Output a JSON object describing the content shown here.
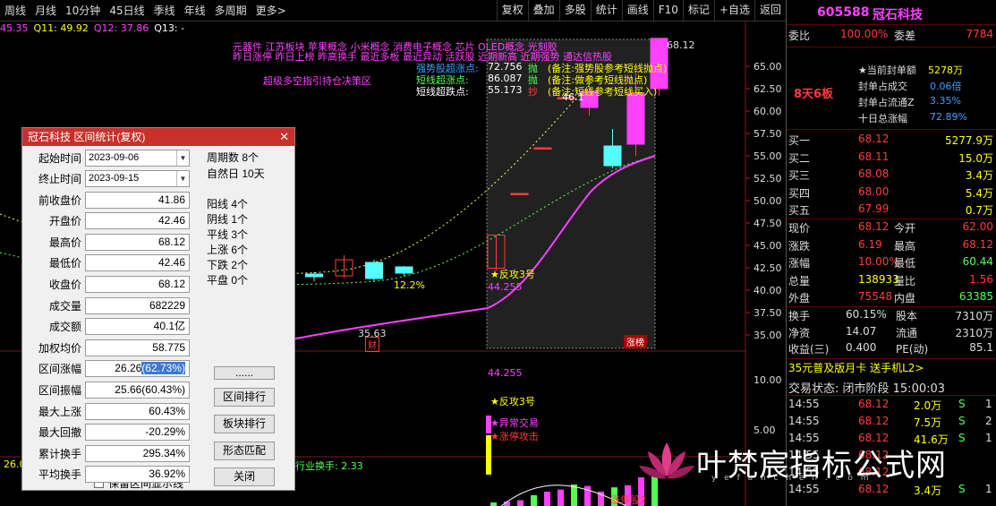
{
  "toolbar": {
    "left": [
      "周线",
      "月线",
      "10分钟",
      "45日线",
      "季线",
      "年线",
      "多周期",
      "更多>"
    ],
    "right": [
      "复权",
      "叠加",
      "多股",
      "统计",
      "画线",
      "F10",
      "标记",
      "+自选",
      "返回"
    ]
  },
  "ma_line": [
    {
      "text": "45.35",
      "color": "#ff40ff"
    },
    {
      "text": "Q11: 49.92",
      "color": "#ffff00"
    },
    {
      "text": "Q12: 37.86",
      "color": "#ff40ff"
    },
    {
      "text": "Q13: -",
      "color": "#ffffff"
    }
  ],
  "chart": {
    "y_axis_labels": [
      "65.00",
      "62.50",
      "60.00",
      "57.50",
      "55.00",
      "52.50",
      "50.00",
      "47.50",
      "45.00",
      "42.50",
      "40.00",
      "37.50",
      "35.00"
    ],
    "sub_axis_labels": [
      "10.00",
      "5.00"
    ],
    "high_price_label": "68.12",
    "low_price_label": "35.63",
    "pct_label": "12.2%",
    "start_marker": "46.1",
    "concepts_line1": "元器件  江苏板块  苹果概念 小米概念 消费电子概念 芯片 OLED概念 光刻胶",
    "concepts_line2": "昨日涨停 昨日上榜 昨高换手 最近多板 最近异动 活跃股 近期新高 近期强势 通达信热股",
    "indicator1": "超级多空指引持仓决策区",
    "signals": [
      {
        "label": "强势股超涨点:",
        "value": "72.756",
        "action": "抛",
        "note": "(备注:强势股参考短线抛点)"
      },
      {
        "label": "短线超涨点:",
        "value": "86.087",
        "action": "抛",
        "note": "(备注:做参考短线抛点)"
      },
      {
        "label": "短线超跌点:",
        "value": "55.173",
        "action": "抄",
        "note": "(备注:短线参考短线买入)"
      }
    ],
    "counter_attack": "★反攻3号",
    "counter_value": "44.255",
    "sub_counter_value": "44.255",
    "sub_counter_attack": "★反攻3号",
    "abnormal": "★异常交易",
    "limit_attack": "★涨停攻击",
    "industry_turnover": "行业换手: 2.33",
    "badge_cai": "财",
    "badge_zhangbang": "涨榜",
    "sub_level": "26.0",
    "bottom_note": "涨停股2"
  },
  "candles": [
    {
      "o": 36.9,
      "c": 37.1,
      "h": 37.4,
      "l": 36.6
    },
    {
      "o": 37.0,
      "c": 38.2,
      "h": 38.4,
      "l": 36.8
    },
    {
      "o": 37.4,
      "c": 38.7,
      "h": 38.9,
      "l": 37.2
    },
    {
      "o": 38.3,
      "c": 38.3,
      "h": 38.8,
      "l": 35.63
    },
    {
      "o": 38.2,
      "c": 38.5,
      "h": 38.7,
      "l": 37.9
    },
    {
      "o": 39.0,
      "c": 40.3,
      "h": 40.6,
      "l": 38.7
    },
    {
      "o": 41.1,
      "c": 39.9,
      "h": 41.5,
      "l": 39.6
    },
    {
      "o": 39.9,
      "c": 41.2,
      "h": 41.6,
      "l": 39.5
    },
    {
      "o": 41.2,
      "c": 40.8,
      "h": 42.0,
      "l": 40.3
    },
    {
      "o": 41.8,
      "c": 41.5,
      "h": 42.0,
      "l": 41.0
    },
    {
      "o": 41.6,
      "c": 43.4,
      "h": 43.9,
      "l": 41.4
    },
    {
      "o": 43.1,
      "c": 41.3,
      "h": 43.4,
      "l": 41.0
    },
    {
      "o": 42.6,
      "c": 41.9,
      "h": 42.7,
      "l": 41.6
    },
    {
      "o": 42.46,
      "c": 46.15,
      "h": 46.2,
      "l": 42.2
    },
    {
      "o": 50.8,
      "c": 50.8,
      "h": 50.8,
      "l": 50.8
    },
    {
      "o": 55.9,
      "c": 55.9,
      "h": 55.9,
      "l": 55.9
    },
    {
      "o": 61.5,
      "c": 61.5,
      "h": 61.5,
      "l": 61.5
    },
    {
      "o": 60.4,
      "c": 62.2,
      "h": 64.0,
      "l": 59.5
    },
    {
      "o": 56.1,
      "c": 53.9,
      "h": 58.0,
      "l": 53.6
    },
    {
      "o": 56.3,
      "c": 62.0,
      "h": 64.5,
      "l": 55.0
    },
    {
      "o": 62.5,
      "c": 68.12,
      "h": 68.12,
      "l": 61.7
    }
  ],
  "dialog": {
    "title": "冠石科技 区间统计(复权)",
    "close": "✕",
    "start_label": "起始时间",
    "start_value": "2023-09-06",
    "end_label": "终止时间",
    "end_value": "2023-09-15",
    "rows": [
      {
        "label": "前收盘价",
        "value": "41.86"
      },
      {
        "label": "开盘价",
        "value": "42.46"
      },
      {
        "label": "最高价",
        "value": "68.12"
      },
      {
        "label": "最低价",
        "value": "42.46"
      },
      {
        "label": "收盘价",
        "value": "68.12"
      },
      {
        "label": "成交量",
        "value": "682229"
      },
      {
        "label": "成交额",
        "value": "40.1亿"
      },
      {
        "label": "加权均价",
        "value": "58.775"
      },
      {
        "label": "区间涨幅",
        "value": "26.26",
        "hl": "(62.73%)"
      },
      {
        "label": "区间振幅",
        "value": "25.66(60.43%)"
      },
      {
        "label": "最大上涨",
        "value": "60.43%"
      },
      {
        "label": "最大回撤",
        "value": "-20.29%"
      },
      {
        "label": "累计换手",
        "value": "295.34%"
      },
      {
        "label": "平均换手",
        "value": "36.92%"
      }
    ],
    "stats_top": [
      "周期数 8个",
      "自然日 10天"
    ],
    "stats_mid": [
      "阳线 4个",
      "阴线 1个",
      "平线 3个",
      "上涨 6个",
      "下跌 2个",
      "平盘 0个"
    ],
    "buttons": [
      "......",
      "区间排行",
      "板块排行",
      "形态匹配",
      "关闭"
    ],
    "checkbox": "保留区间显示线"
  },
  "panel": {
    "code": "605588",
    "name": "冠石科技",
    "weibi_label": "委比",
    "weibi_value": "100.00%",
    "weicha_label": "委差",
    "weicha_value": "7784",
    "streak": "8天6板",
    "seal_info": [
      {
        "label": "★当前封单额",
        "value": "5278万"
      },
      {
        "label": "封单占成交",
        "value": "0.06倍"
      },
      {
        "label": "封单占流通Z",
        "value": "3.35%"
      },
      {
        "label": "十日总涨幅",
        "value": "72.89%"
      }
    ],
    "bids": [
      {
        "label": "买一",
        "price": "68.12",
        "vol": "5277.9万"
      },
      {
        "label": "买二",
        "price": "68.11",
        "vol": "15.0万"
      },
      {
        "label": "买三",
        "price": "68.08",
        "vol": "3.4万"
      },
      {
        "label": "买四",
        "price": "68.00",
        "vol": "5.4万"
      },
      {
        "label": "买五",
        "price": "67.99",
        "vol": "0.7万"
      }
    ],
    "quote": [
      {
        "l1": "现价",
        "v1": "68.12",
        "l2": "今开",
        "v2": "62.00"
      },
      {
        "l1": "涨跌",
        "v1": "6.19",
        "l2": "最高",
        "v2": "68.12"
      },
      {
        "l1": "涨幅",
        "v1": "10.00%",
        "l2": "最低",
        "v2": "60.44"
      },
      {
        "l1": "总量",
        "v1": "138933",
        "l2": "量比",
        "v2": "1.56"
      },
      {
        "l1": "外盘",
        "v1": "75548",
        "l2": "内盘",
        "v2": "63385"
      }
    ],
    "fundamentals": [
      {
        "l1": "换手",
        "v1": "60.15%",
        "l2": "股本",
        "v2": "7310万"
      },
      {
        "l1": "净资",
        "v1": "14.07",
        "l2": "流通",
        "v2": "2310万"
      },
      {
        "l1": "收益(三)",
        "v1": "0.400",
        "l2": "PE(动)",
        "v2": "85.1"
      }
    ],
    "promo": "35元普及版月卡 送手机L2>",
    "trade_status": "交易状态: 闭市阶段 15:00:03",
    "ticks": [
      {
        "time": "14:55",
        "price": "68.12",
        "vol": "2.0万",
        "side": "S",
        "n": "1"
      },
      {
        "time": "14:55",
        "price": "68.12",
        "vol": "7.5万",
        "side": "S",
        "n": "2"
      },
      {
        "time": "14:55",
        "price": "68.12",
        "vol": "41.6万",
        "side": "S",
        "n": "1"
      },
      {
        "time": "14:55",
        "price": "68.12",
        "vol": "",
        "side": "",
        "n": ""
      },
      {
        "time": "14:55",
        "price": "68.12",
        "vol": "",
        "side": "",
        "n": ""
      },
      {
        "time": "14:55",
        "price": "68.12",
        "vol": "3.4万",
        "side": "S",
        "n": "1"
      }
    ]
  },
  "watermark": {
    "text": "叶梵宸指标公式网",
    "sub": "y e f a n c h e n . c o m"
  },
  "colors": {
    "up": "#ff3b3b",
    "down": "#54ffff",
    "flat": "#ffffff",
    "magenta": "#ff40ff",
    "yellow": "#ffff00",
    "dialog_title": "#c9302c"
  }
}
